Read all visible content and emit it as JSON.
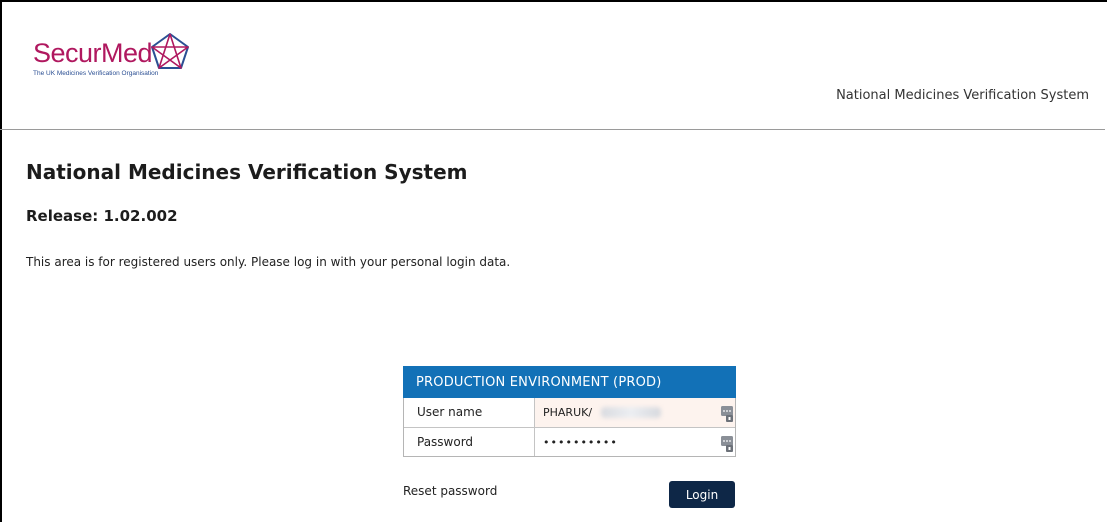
{
  "header": {
    "logo_text": "SecurMed",
    "logo_tagline": "The UK Medicines Verification Organisation",
    "system_name": "National Medicines Verification System"
  },
  "main": {
    "title": "National Medicines Verification System",
    "release": "Release: 1.02.002",
    "intro": "This area is for registered users only. Please log in with your personal login data."
  },
  "login": {
    "environment": "PRODUCTION ENVIRONMENT (PROD)",
    "username_label": "User name",
    "username_value": "PHARUK/",
    "password_label": "Password",
    "password_value": "••••••••••",
    "reset_label": "Reset password",
    "login_label": "Login"
  },
  "colors": {
    "brand": "#b0185f",
    "brand_secondary": "#2b4f93",
    "panel_header": "#1271b7",
    "login_button": "#0e2747"
  },
  "icons": {
    "logo_mark": "pentagon-star-icon",
    "field_action": "password-manager-key-icon"
  }
}
